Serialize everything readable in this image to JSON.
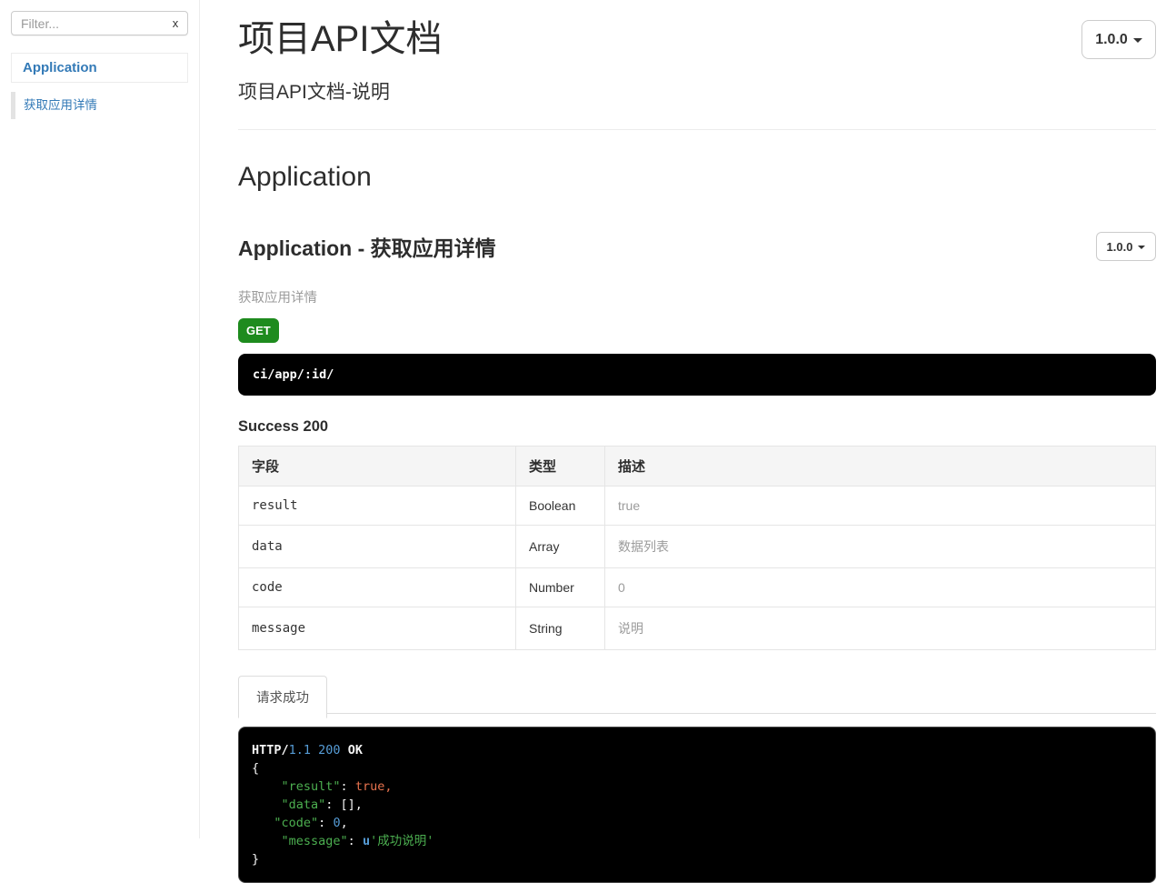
{
  "sidebar": {
    "filter": {
      "placeholder": "Filter...",
      "clear_label": "x"
    },
    "groups": [
      {
        "label": "Application",
        "items": [
          {
            "label": "获取应用详情"
          }
        ]
      }
    ]
  },
  "header": {
    "title": "项目API文档",
    "subtitle": "项目API文档-说明",
    "version": "1.0.0"
  },
  "section": {
    "group_title": "Application",
    "article_title": "Application - 获取应用详情",
    "version": "1.0.0",
    "description": "获取应用详情",
    "method": "GET",
    "endpoint": "ci/app/:id/",
    "success_title": "Success 200",
    "table": {
      "headers": [
        "字段",
        "类型",
        "描述"
      ],
      "rows": [
        {
          "field": "result",
          "type": "Boolean",
          "description": "true"
        },
        {
          "field": "data",
          "type": "Array",
          "description": "数据列表"
        },
        {
          "field": "code",
          "type": "Number",
          "description": "0"
        },
        {
          "field": "message",
          "type": "String",
          "description": "说明"
        }
      ]
    },
    "tab": {
      "label": "请求成功"
    },
    "example": {
      "lines": [
        [
          {
            "t": "HTTP/",
            "s": "bold"
          },
          {
            "t": "1.1 200",
            "s": "number"
          },
          {
            "t": " ",
            "s": "plain"
          },
          {
            "t": "OK",
            "s": "bold"
          }
        ],
        [
          {
            "t": "{",
            "s": "plain"
          }
        ],
        [
          {
            "t": "    ",
            "s": "plain"
          },
          {
            "t": "\"result\"",
            "s": "key"
          },
          {
            "t": ": ",
            "s": "plain"
          },
          {
            "t": "true,",
            "s": "boolean"
          }
        ],
        [
          {
            "t": "    ",
            "s": "plain"
          },
          {
            "t": "\"data\"",
            "s": "key"
          },
          {
            "t": ": [],",
            "s": "plain"
          }
        ],
        [
          {
            "t": "   ",
            "s": "plain"
          },
          {
            "t": "\"code\"",
            "s": "key"
          },
          {
            "t": ": ",
            "s": "plain"
          },
          {
            "t": "0",
            "s": "number"
          },
          {
            "t": ",",
            "s": "plain"
          }
        ],
        [
          {
            "t": "    ",
            "s": "plain"
          },
          {
            "t": "\"message\"",
            "s": "key"
          },
          {
            "t": ": ",
            "s": "plain"
          },
          {
            "t": "u",
            "s": "unicode"
          },
          {
            "t": "'成功说明'",
            "s": "string"
          }
        ],
        [
          {
            "t": "}",
            "s": "plain"
          }
        ]
      ]
    }
  },
  "colors": {
    "link_blue": "#337ab7",
    "method_get_green": "#1e8b1e",
    "code_key_green": "#4caf50",
    "code_number_blue": "#569cd6",
    "code_boolean_orange": "#e8734e",
    "code_string_green": "#4caf50",
    "code_background": "#000000",
    "table_header_bg": "#f5f5f5"
  }
}
